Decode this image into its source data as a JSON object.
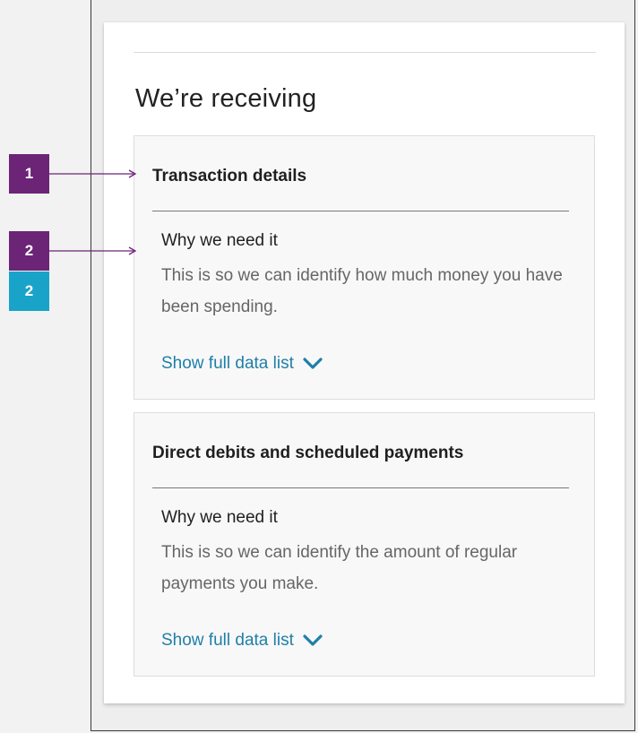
{
  "section": {
    "title": "We’re receiving"
  },
  "panels": [
    {
      "heading": "Transaction details",
      "why_label": "Why we need it",
      "why_text": "This is so we can identify how much money you have been spending.",
      "link_label": "Show full data list"
    },
    {
      "heading": "Direct debits and scheduled payments",
      "why_label": "Why we need it",
      "why_text": "This is so we can identify the amount of regular payments you make.",
      "link_label": "Show full data list"
    }
  ],
  "annotations": {
    "marker_1": "1",
    "marker_2": "2",
    "marker_3": "2"
  },
  "colors": {
    "marker_purple": "#6b2476",
    "marker_cyan": "#1aa3c8",
    "link_blue": "#1f7fa8"
  }
}
